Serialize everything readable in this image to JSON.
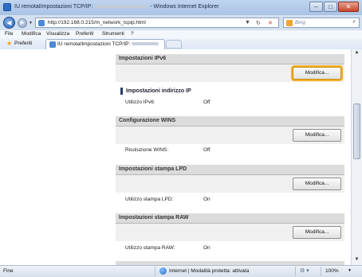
{
  "window": {
    "title_prefix": "IU remotaIImpostazioni TCP/IP:",
    "title_suffix": "- Windows Internet Explorer",
    "minimize": "–",
    "maximize": "□",
    "close": "✕"
  },
  "navigation": {
    "back": "◀",
    "forward": "▶",
    "dropdown": "▼",
    "url": "http://192.168.0.215/m_network_tcpip.html",
    "refresh": "↻",
    "stop": "✕",
    "search_placeholder": "Bing",
    "search_icon": "⌕"
  },
  "menu": {
    "items": [
      "File",
      "Modifica",
      "Visualizza",
      "Preferiti",
      "Strumenti",
      "?"
    ]
  },
  "favorites": {
    "label": "Preferiti",
    "tab_title": "IU remotaIImpostazioni TCP/IP:"
  },
  "sections": {
    "ipv6": {
      "header": "Impostazioni IPv6",
      "button": "Modifica...",
      "subhead": "Impostazioni indirizzo IP",
      "field_label": "Utilizzo IPv6:",
      "field_value": "Off"
    },
    "wins": {
      "header": "Configurazione WINS",
      "button": "Modifica...",
      "field_label": "Risoluzione WINS:",
      "field_value": "Off"
    },
    "lpd": {
      "header": "Impostazioni stampa LPD",
      "button": "Modifica...",
      "field_label": "Utilizzo stampa LPD:",
      "field_value": "On"
    },
    "raw": {
      "header": "Impostazioni stampa RAW",
      "button": "Modifica...",
      "field_label": "Utilizzo stampa RAW:",
      "field_value": "On"
    }
  },
  "status": {
    "left": "Fine",
    "zone": "Internet | Modalità protetta: attivata",
    "zoom": "100%",
    "zoom_caret": "▼",
    "tools": "⚙ ▾"
  },
  "scrollbar": {
    "up": "▲",
    "down": "▼"
  }
}
